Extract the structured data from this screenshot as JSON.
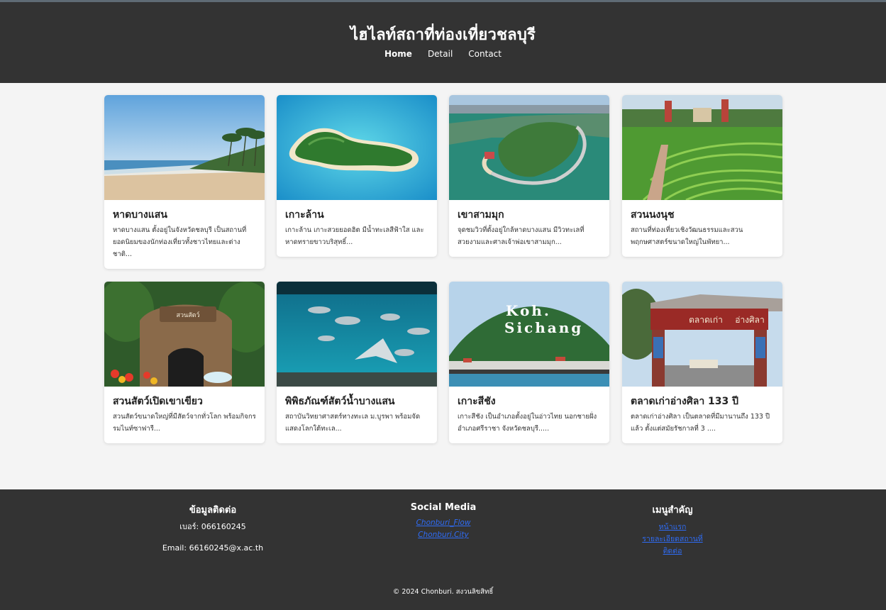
{
  "header": {
    "title": "ไฮไลท์สถาที่ท่องเที่ยวชลบุรี",
    "nav": [
      {
        "label": "Home",
        "active": true
      },
      {
        "label": "Detail",
        "active": false
      },
      {
        "label": "Contact",
        "active": false
      }
    ]
  },
  "cards": [
    {
      "title": "หาดบางแสน",
      "desc": "หาดบางแสน ตั้งอยู่ในจังหวัดชลบุรี เป็นสถานที่ยอดนิยมของนักท่องเที่ยวทั้งชาวไทยและต่างชาติ...",
      "image": "beach-photo"
    },
    {
      "title": "เกาะล้าน",
      "desc": "เกาะล้าน เกาะสวยยอดฮิต มีน้ำทะเลสีฟ้าใส และหาดทรายขาวบริสุทธิ์...",
      "image": "island-aerial-photo"
    },
    {
      "title": "เขาสามมุก",
      "desc": "จุดชมวิวที่ตั้งอยู่ใกล้หาดบางแสน มีวิวทะเลที่สวยงามและศาลเจ้าพ่อเขาสามมุก...",
      "image": "hill-coast-photo"
    },
    {
      "title": "สวนนงนุช",
      "desc": "สถานที่ท่องเที่ยวเชิงวัฒนธรรมและสวนพฤกษศาสตร์ขนาดใหญ่ในพัทยา...",
      "image": "garden-photo"
    },
    {
      "title": "สวนสัตว์เปิดเขาเขียว",
      "desc": "สวนสัตว์ขนาดใหญ่ที่มีสัตว์จากทั่วโลก พร้อมกิจกรรมไนท์ซาฟารี...",
      "image": "zoo-entrance-photo"
    },
    {
      "title": "พิพิธภัณฑ์สัตว์น้ำบางแสน",
      "desc": "สถาบันวิทยาศาสตร์ทางทะเล ม.บูรพา พร้อมจัดแสดงโลกใต้ทะเล...",
      "image": "aquarium-photo"
    },
    {
      "title": "เกาะสีชัง",
      "desc": "เกาะสีชัง เป็นอำเภอตั้งอยู่ในอ่าวไทย นอกชายฝั่งอำเภอศรีราชา จังหวัดชลบุรี.....",
      "image": "koh-sichang-photo",
      "overlay": [
        "Koh.",
        "Sichang"
      ]
    },
    {
      "title": "ตลาดเก่าอ่างศิลา 133 ปี",
      "desc": "ตลาดเก่าอ่างศิลา เป็นตลาดที่มีมานานถึง 133 ปีแล้ว ตั้งแต่สมัยรัชกาลที่ 3 ....",
      "image": "old-market-gate-photo",
      "overlay": [
        "ตลาดเก่า",
        "อ่างศิลา"
      ]
    }
  ],
  "footer": {
    "contact": {
      "heading": "ข้อมูลติดต่อ",
      "phone": "เบอร์: 066160245",
      "email": "Email: 66160245@x.ac.th"
    },
    "social": {
      "heading": "Social Media",
      "links": [
        "Chonburi_Flow",
        "Chonburi.City"
      ]
    },
    "menu": {
      "heading": "เมนูสำคัญ",
      "links": [
        "หน้าแรก",
        "รายละเอียดสถานที่",
        "ติดต่อ"
      ]
    },
    "copyright": "© 2024 Chonburi. สงวนลิขสิทธิ์"
  },
  "colors": {
    "header_bg": "#333333",
    "footer_bg": "#333333",
    "link": "#2f6cf5",
    "page_bg": "#f4f4f4"
  }
}
